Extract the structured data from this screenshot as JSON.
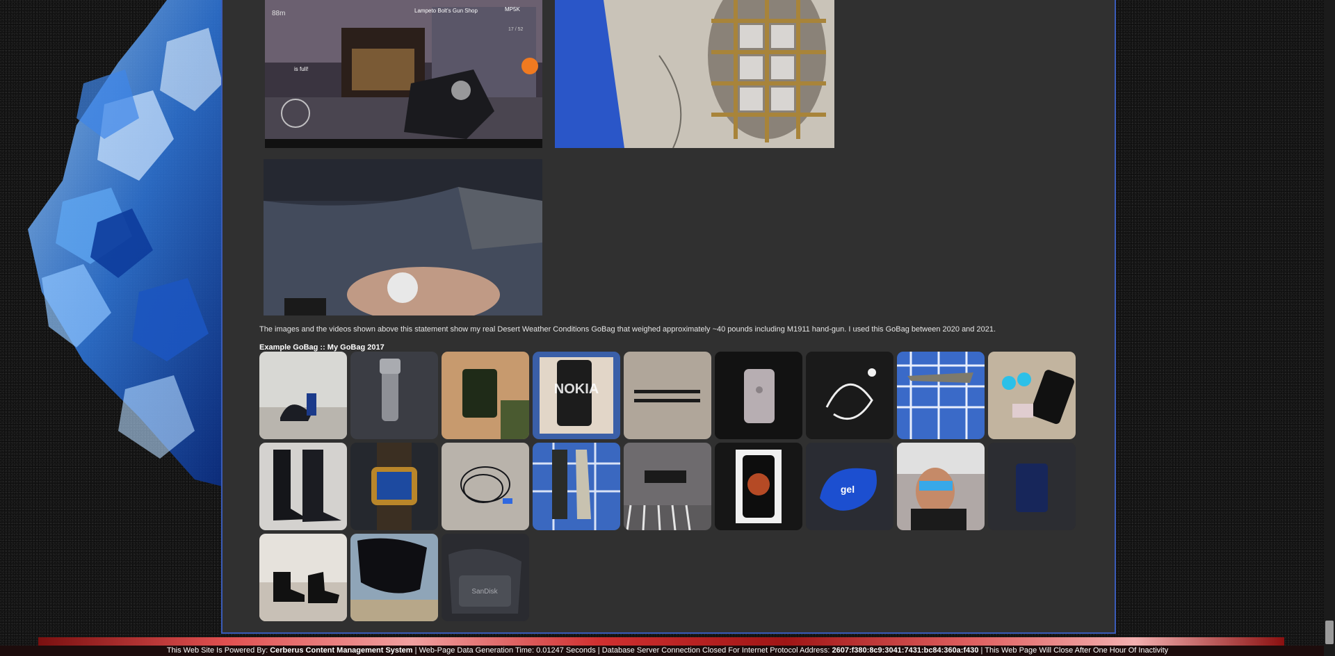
{
  "content": {
    "statement": "The images and the videos shown above this statement show my real Desert Weather Conditions GoBag that weighed approximately ~40 pounds including M1911 hand-gun. I used this GoBag between 2020 and 2021.",
    "gallery_heading": "Example GoBag :: My GoBag 2017"
  },
  "game_screenshot": {
    "mission_text": "Lampeto Bolt's Gun Shop",
    "weapon": "MP5K",
    "ammo": "17 / 52",
    "distance": "88m",
    "status": "is full!"
  },
  "box_text": {
    "nokia": "NOKIA",
    "gel_insoles": "gel",
    "sandisk": "SanDisk"
  },
  "gallery": {
    "items": [
      {
        "icon": "shoes-and-bag"
      },
      {
        "icon": "flashlight"
      },
      {
        "icon": "zippo-lighter"
      },
      {
        "icon": "nokia-phone-box"
      },
      {
        "icon": "pens"
      },
      {
        "icon": "iphone"
      },
      {
        "icon": "earphones"
      },
      {
        "icon": "folding-knife"
      },
      {
        "icon": "sunglasses-and-wallet"
      },
      {
        "icon": "boots-pair"
      },
      {
        "icon": "wristwatch"
      },
      {
        "icon": "cable"
      },
      {
        "icon": "fixed-blade-knife"
      },
      {
        "icon": "scarf"
      },
      {
        "icon": "iphone-box"
      },
      {
        "icon": "gel-insoles"
      },
      {
        "icon": "selfie"
      },
      {
        "icon": "power-bank"
      },
      {
        "icon": "boots-side"
      },
      {
        "icon": "boots-top"
      },
      {
        "icon": "sandisk-pouch"
      }
    ]
  },
  "footer": {
    "powered_prefix": "This Web Site Is Powered By: ",
    "cms_name": "Cerberus Content Management System",
    "generation_text": " | Web-Page Data Generation Time: 0.01247 Seconds | Database Server Connection Closed For Internet Protocol Address: ",
    "ip_address": "2607:f380:8c9:3041:7431:bc84:360a:f430",
    "inactivity_text": " |  This Web Page Will Close After One Hour Of Inactivity"
  },
  "colors": {
    "panel_background": "#303030",
    "panel_border": "#3a5bb8",
    "accent_blue": "#2c6be0",
    "footer_red": "#c02525"
  }
}
